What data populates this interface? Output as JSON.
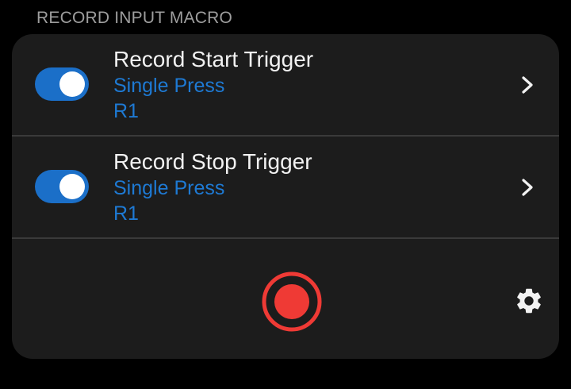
{
  "section": {
    "title": "RECORD INPUT MACRO"
  },
  "triggers": [
    {
      "title": "Record Start Trigger",
      "mode": "Single Press",
      "button": "R1",
      "enabled": true
    },
    {
      "title": "Record Stop Trigger",
      "mode": "Single Press",
      "button": "R1",
      "enabled": true
    }
  ],
  "icons": {
    "chevron": "chevron-right-icon",
    "record": "record-icon",
    "settings": "gear-icon"
  },
  "colors": {
    "accent": "#1b6fc8",
    "accent_text": "#1e7ad4",
    "record": "#ef3a35",
    "card_background": "#1c1c1c",
    "page_background": "#000000"
  }
}
